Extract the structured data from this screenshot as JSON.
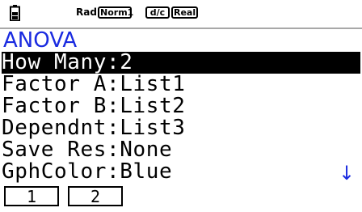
{
  "status_bar": {
    "battery_icon": "battery-icon",
    "angle_mode": "Rad",
    "display_mode": "Norm1",
    "fraction_mode": "d/c",
    "complex_mode": "Real"
  },
  "title": "ANOVA",
  "rows": [
    {
      "label": "How Many",
      "value": "2",
      "selected": true
    },
    {
      "label": "Factor A",
      "value": "List1",
      "selected": false
    },
    {
      "label": "Factor B",
      "value": "List2",
      "selected": false
    },
    {
      "label": "Dependnt",
      "value": "List3",
      "selected": false
    },
    {
      "label": "Save Res",
      "value": "None",
      "selected": false
    },
    {
      "label": "GphColor",
      "value": "Blue",
      "selected": false
    }
  ],
  "separator": ":",
  "scroll_indicator": "↓",
  "function_keys": [
    {
      "label": "1"
    },
    {
      "label": "2"
    }
  ],
  "colors": {
    "title": "#1a2be0",
    "scroll_indicator": "#1a2be0",
    "selection_background": "#000000",
    "selection_text": "#ffffff"
  }
}
